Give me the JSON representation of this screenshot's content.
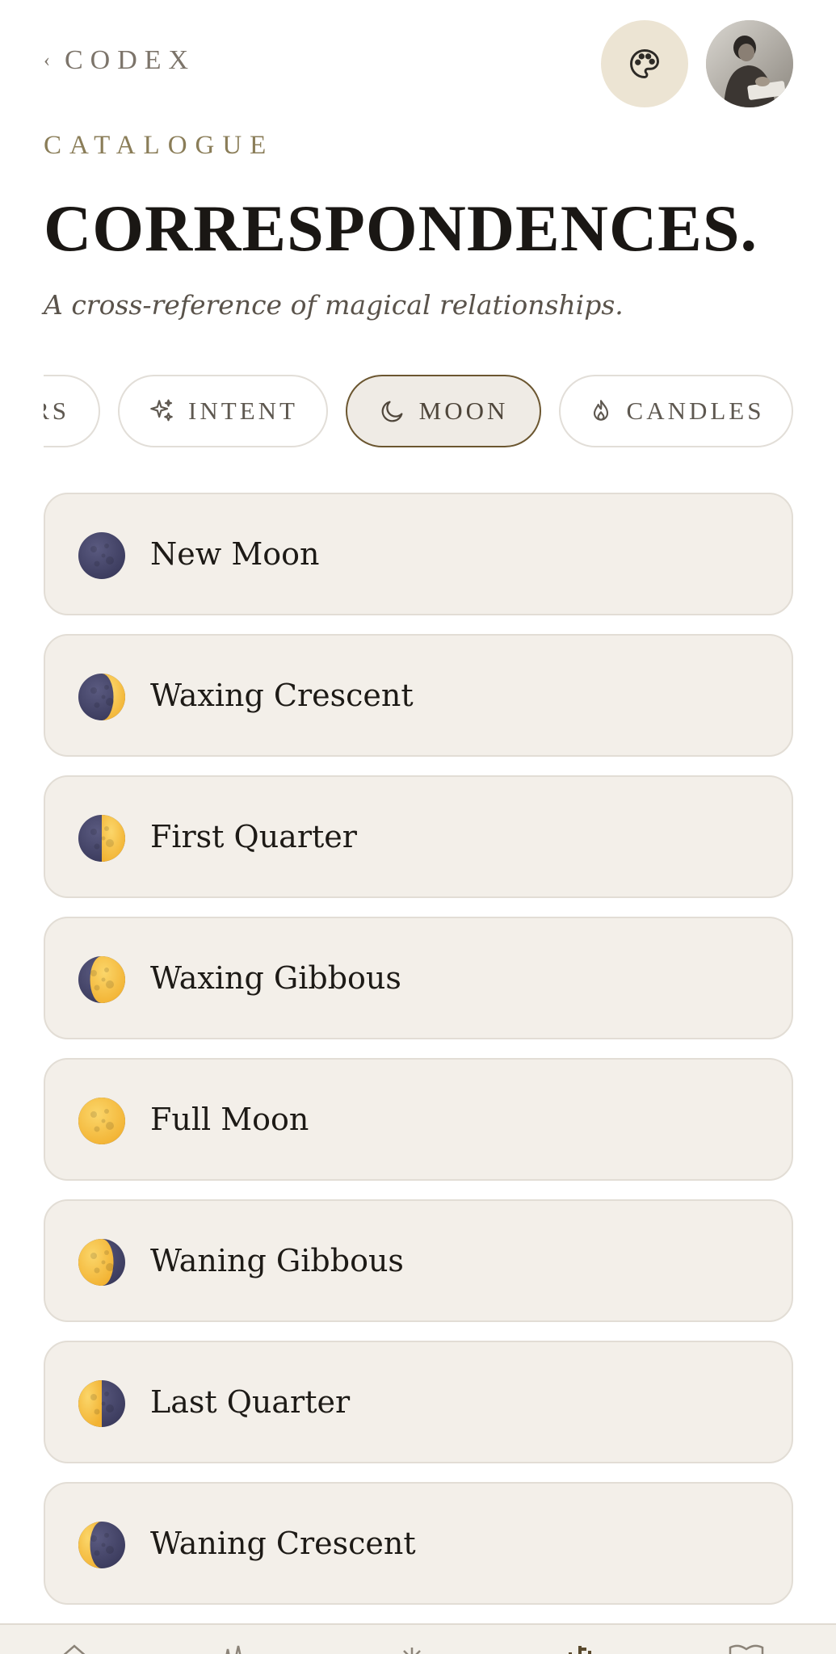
{
  "header": {
    "back_label": "CODEX",
    "back_chevron": "‹",
    "palette_icon": "palette-icon",
    "avatar_icon": "profile-avatar"
  },
  "page": {
    "eyebrow": "CATALOGUE",
    "title": "CORRESPONDENCES.",
    "subtitle": "A cross-reference of magical relationships."
  },
  "tabs": [
    {
      "label": "RS",
      "icon": "",
      "active": false
    },
    {
      "label": "INTENT",
      "icon": "sparkles-icon",
      "active": false
    },
    {
      "label": "MOON",
      "icon": "crescent-moon-icon",
      "active": true
    },
    {
      "label": "CANDLES",
      "icon": "flame-icon",
      "active": false
    }
  ],
  "phases": [
    {
      "label": "New Moon",
      "icon": "new-moon-icon",
      "lit_fraction": 0.0
    },
    {
      "label": "Waxing Crescent",
      "icon": "waxing-crescent-icon",
      "lit_fraction": 0.25
    },
    {
      "label": "First Quarter",
      "icon": "first-quarter-icon",
      "lit_fraction": 0.5
    },
    {
      "label": "Waxing Gibbous",
      "icon": "waxing-gibbous-icon",
      "lit_fraction": 0.75
    },
    {
      "label": "Full Moon",
      "icon": "full-moon-icon",
      "lit_fraction": 1.0
    },
    {
      "label": "Waning Gibbous",
      "icon": "waning-gibbous-icon",
      "lit_fraction": 0.75
    },
    {
      "label": "Last Quarter",
      "icon": "last-quarter-icon",
      "lit_fraction": 0.5
    },
    {
      "label": "Waning Crescent",
      "icon": "waning-crescent-icon",
      "lit_fraction": 0.25
    }
  ],
  "bottom_nav": [
    {
      "icon": "home-icon"
    },
    {
      "icon": "sparkles-icon"
    },
    {
      "icon": "sun-icon"
    },
    {
      "icon": "chart-icon"
    },
    {
      "icon": "book-icon"
    }
  ],
  "colors": {
    "accent": "#6b5630",
    "card_background": "#f3efe9",
    "palette_button": "#ece4d3",
    "moon_dark": "#3a3a5c",
    "moon_light": "#f2b232"
  }
}
